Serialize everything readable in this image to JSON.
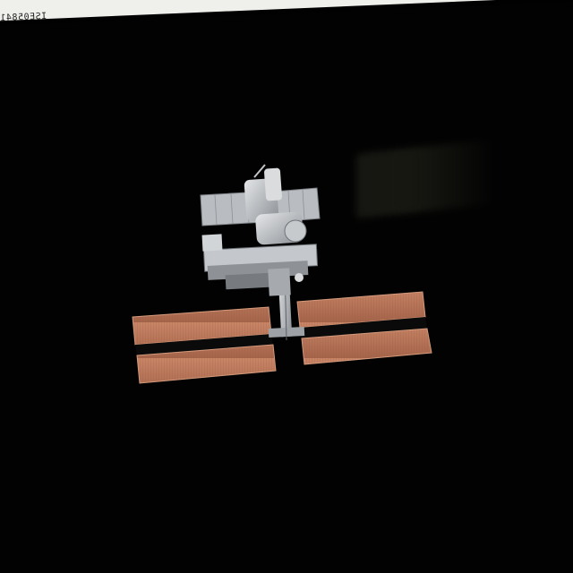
{
  "photo": {
    "frame_code": "ISE05841"
  },
  "colors": {
    "space": "#020202",
    "solar_array": "#b8735a",
    "solar_array_dark": "#7a4634",
    "module_silver": "#c9cdd2",
    "radiator": "#a8acb0"
  },
  "subject": {
    "icon": "space-station-icon"
  }
}
